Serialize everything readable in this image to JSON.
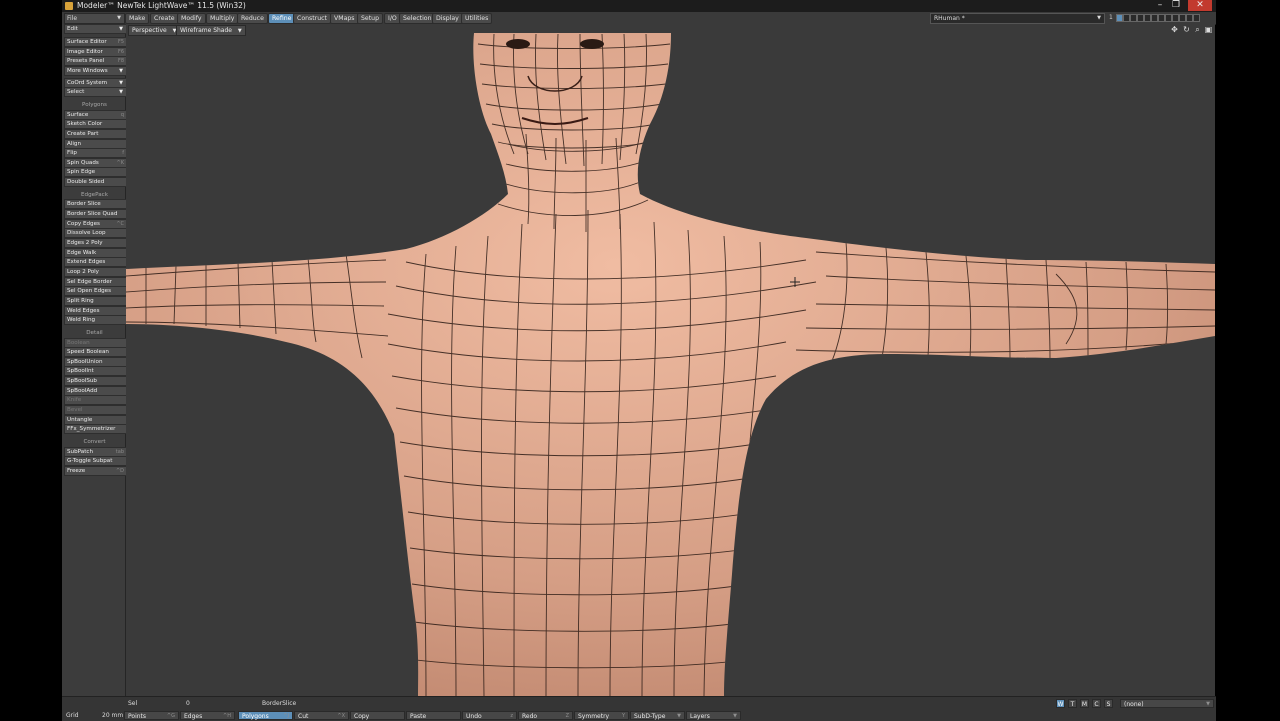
{
  "window": {
    "title": "Modeler™ NewTek LightWave™ 11.5 (Win32)",
    "minimize": "–",
    "maximize": "❐",
    "close": "✕"
  },
  "menus": {
    "file": "File",
    "edit": "Edit"
  },
  "tabs": [
    {
      "label": "Make"
    },
    {
      "label": "Create"
    },
    {
      "label": "Modify"
    },
    {
      "label": "Multiply"
    },
    {
      "label": "Reduce"
    },
    {
      "label": "Refine",
      "active": true
    },
    {
      "label": "Construct"
    },
    {
      "label": "VMaps"
    },
    {
      "label": "Setup"
    },
    {
      "label": "I/O"
    },
    {
      "label": "Selection"
    },
    {
      "label": "Display"
    },
    {
      "label": "Utilities"
    }
  ],
  "layer": {
    "object": "RHuman *",
    "indicator": "1"
  },
  "sidebar": {
    "top_items": [
      {
        "label": "Surface Editor",
        "hotkey": "F5"
      },
      {
        "label": "Image Editor",
        "hotkey": "F6"
      },
      {
        "label": "Presets Panel",
        "hotkey": "F8"
      },
      {
        "label": "More Windows",
        "dropdown": true
      }
    ],
    "coord": {
      "label": "CoOrd System"
    },
    "select": {
      "label": "Select"
    },
    "sections": [
      {
        "title": "Polygons",
        "items": [
          {
            "label": "Surface",
            "hotkey": "q"
          },
          {
            "label": "Sketch Color"
          },
          {
            "label": "Create Part"
          },
          {
            "label": "Align"
          },
          {
            "label": "Flip",
            "hotkey": "f"
          },
          {
            "label": "Spin Quads",
            "hotkey": "^K"
          },
          {
            "label": "Spin Edge"
          },
          {
            "label": "Double Sided"
          }
        ]
      },
      {
        "title": "EdgePack",
        "items": [
          {
            "label": "Border Slice"
          },
          {
            "label": "Border Slice Quad"
          },
          {
            "label": "Copy Edges",
            "hotkey": "^C"
          },
          {
            "label": "Dissolve Loop"
          },
          {
            "label": "Edges 2 Poly"
          },
          {
            "label": "Edge Walk"
          },
          {
            "label": "Extend Edges"
          },
          {
            "label": "Loop 2 Poly"
          },
          {
            "label": "Sel Edge Border"
          },
          {
            "label": "Sel Open Edges"
          },
          {
            "label": "Split Ring"
          },
          {
            "label": "Weld Edges"
          },
          {
            "label": "Weld Ring"
          }
        ]
      },
      {
        "title": "Detail",
        "items": [
          {
            "label": "Boolean",
            "dim": true
          },
          {
            "label": "Speed Boolean"
          },
          {
            "label": "SpBoolUnion"
          },
          {
            "label": "SpBoolInt"
          },
          {
            "label": "SpBoolSub"
          },
          {
            "label": "SpBoolAdd"
          },
          {
            "label": "Knife",
            "dim": true
          },
          {
            "label": "Bevel",
            "dim": true
          },
          {
            "label": "Untangle"
          },
          {
            "label": "FFx_Symmetrizer"
          }
        ]
      },
      {
        "title": "Convert",
        "items": [
          {
            "label": "SubPatch",
            "hotkey": "tab"
          },
          {
            "label": "G-Toggle Subpat",
            "hotkey": ""
          },
          {
            "label": "Freeze",
            "hotkey": "^D"
          }
        ]
      }
    ]
  },
  "viewport": {
    "view": "Perspective",
    "shading": "Wireframe Shade"
  },
  "status": {
    "sel_label": "Sel",
    "sel_value": "0",
    "tool": "BorderSlice",
    "grid_label": "Grid",
    "grid_value": "20 mm",
    "wtmcs": [
      "W",
      "T",
      "M",
      "C",
      "S"
    ],
    "wtmcs_active": "W",
    "surface_filter": "(none)"
  },
  "bottom_buttons": [
    {
      "label": "Points",
      "hotkey": "^G"
    },
    {
      "label": "Edges",
      "hotkey": "^H"
    },
    {
      "label": "Polygons",
      "hotkey": "^J",
      "active": true
    },
    {
      "label": "Cut",
      "hotkey": "^X"
    },
    {
      "label": "Copy",
      "hotkey": ""
    },
    {
      "label": "Paste",
      "hotkey": ""
    },
    {
      "label": "Undo",
      "hotkey": "z"
    },
    {
      "label": "Redo",
      "hotkey": "Z"
    },
    {
      "label": "Symmetry",
      "hotkey": "Y"
    },
    {
      "label": "SubD-Type",
      "dropdown": true
    },
    {
      "label": "Layers",
      "dropdown": true
    }
  ],
  "colors": {
    "accent": "#5d8fb8",
    "skin": "#d9a289",
    "wire": "#2a1a14",
    "background": "#3a3a3a"
  }
}
